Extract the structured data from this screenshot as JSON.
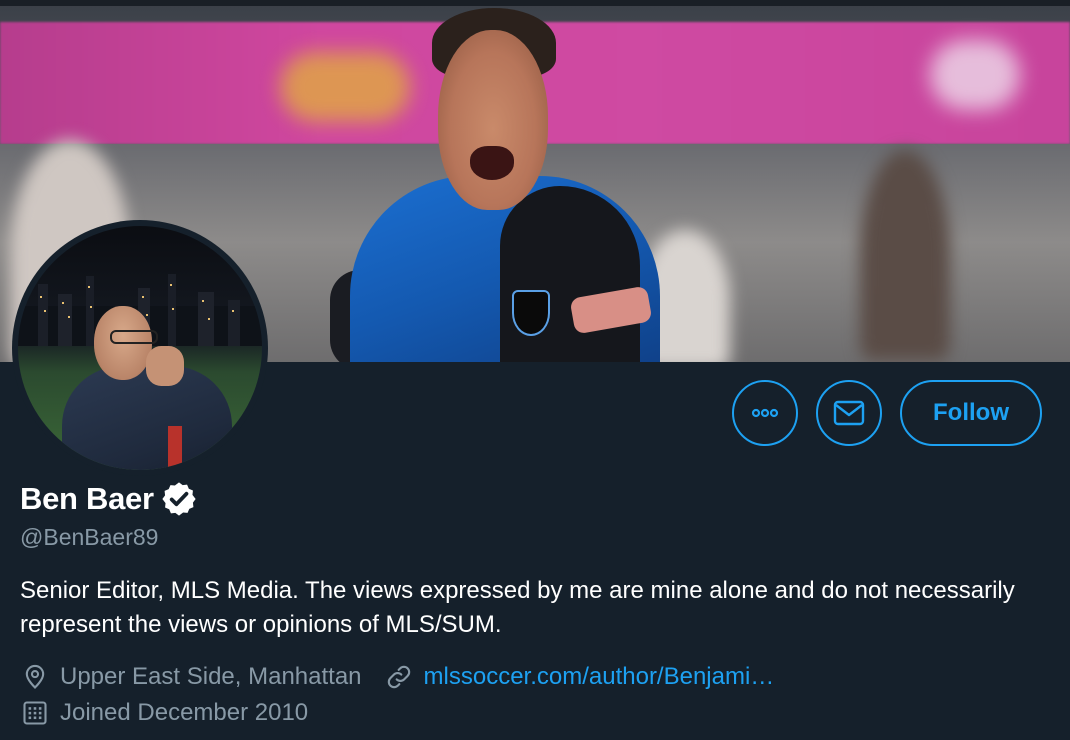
{
  "profile": {
    "display_name": "Ben Baer",
    "handle": "@BenBaer89",
    "verified": true,
    "bio": "Senior Editor, MLS Media. The views expressed by me are mine alone and do not necessarily represent the views or opinions of MLS/SUM.",
    "location": "Upper East Side, Manhattan",
    "website": "mlssoccer.com/author/Benjami…",
    "joined": "Joined December 2010"
  },
  "actions": {
    "more_icon": "more-icon",
    "message_icon": "envelope-icon",
    "follow_label": "Follow"
  },
  "colors": {
    "background": "#15202b",
    "accent": "#1da1f2",
    "secondary_text": "#8899a6"
  }
}
